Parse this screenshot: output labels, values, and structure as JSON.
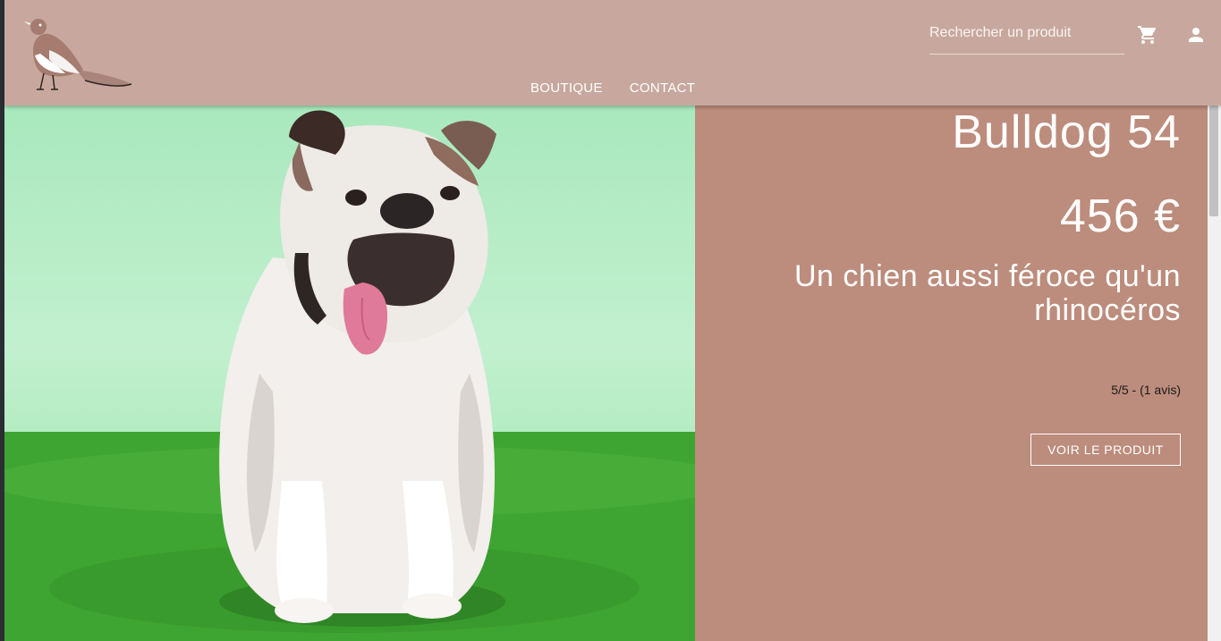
{
  "header": {
    "logo_icon": "bird-logo-icon",
    "search": {
      "placeholder": "Rechercher un produit",
      "value": ""
    },
    "cart_icon": "cart-icon",
    "user_icon": "user-icon",
    "nav": [
      {
        "label": "BOUTIQUE"
      },
      {
        "label": "CONTACT"
      }
    ]
  },
  "product": {
    "image_icon": "bulldog-photo",
    "title": "Bulldog 54",
    "price": "456 €",
    "description": "Un chien aussi féroce qu'un rhinocéros",
    "rating": "5/5 - (1 avis)",
    "button_label": "VOIR LE PRODUIT"
  },
  "colors": {
    "header_bg": "#c8a89e",
    "panel_bg": "#bc8c7c",
    "text": "#ffffff"
  }
}
